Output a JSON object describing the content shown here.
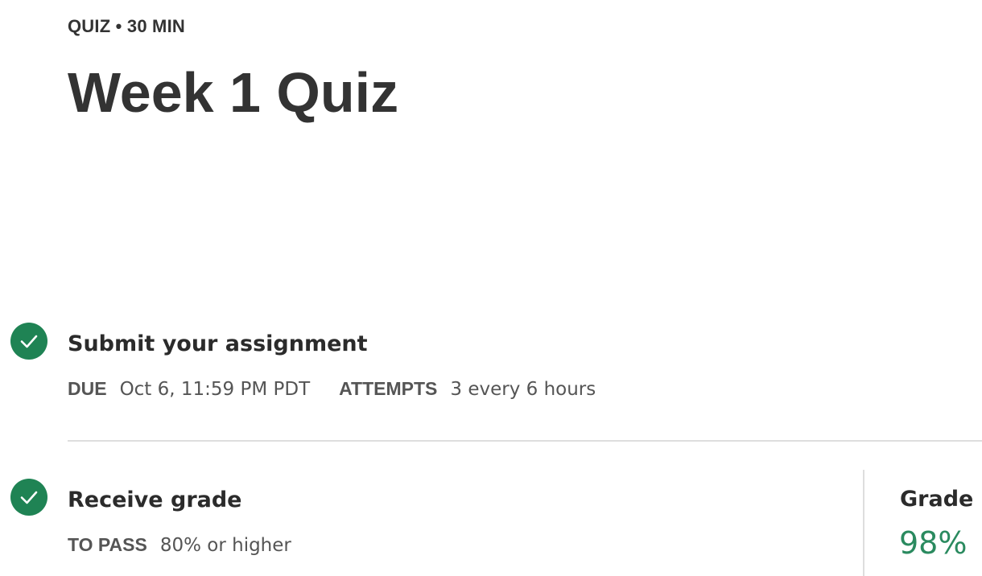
{
  "header": {
    "eyebrow": "QUIZ • 30 MIN",
    "title": "Week 1 Quiz"
  },
  "steps": [
    {
      "title": "Submit your assignment",
      "status_icon": "check-circle-icon",
      "meta": [
        {
          "label": "DUE",
          "value": "Oct 6, 11:59 PM PDT"
        },
        {
          "label": "ATTEMPTS",
          "value": "3 every 6 hours"
        }
      ]
    },
    {
      "title": "Receive grade",
      "status_icon": "check-circle-icon",
      "meta": [
        {
          "label": "TO PASS",
          "value": "80% or higher"
        }
      ]
    }
  ],
  "grade": {
    "label": "Grade",
    "value": "98%"
  },
  "colors": {
    "success_green": "#1f8354",
    "grade_green": "#2a8a5f",
    "text_dark": "#333333",
    "text_muted": "#555555",
    "divider": "#dedede"
  }
}
